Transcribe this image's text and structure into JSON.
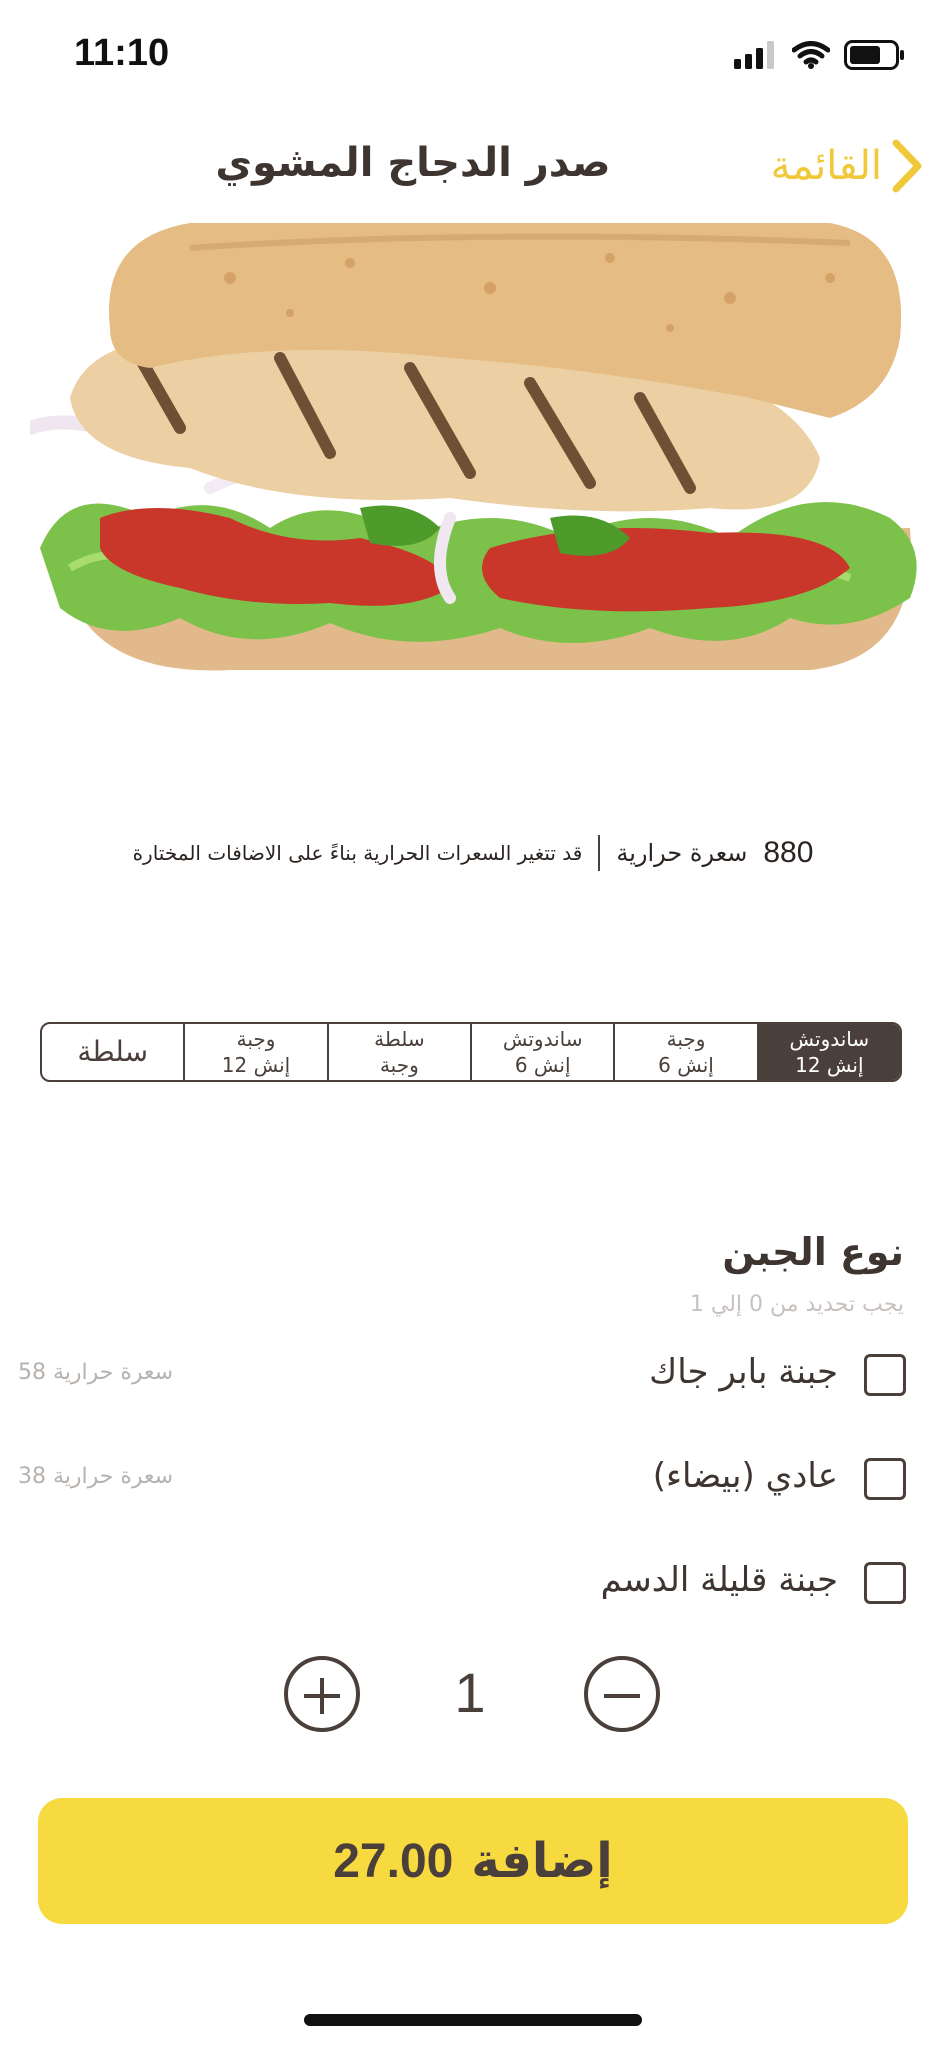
{
  "status": {
    "time": "11:10"
  },
  "nav": {
    "title": "صدر الدجاج المشوي",
    "back_label": "القائمة"
  },
  "calories": {
    "value": "880",
    "unit": "سعرة حرارية",
    "note": "قد تتغير السعرات الحرارية بناءً على الاضافات المختارة"
  },
  "sizes": [
    {
      "line1": "ساندوتش",
      "line2": "12 إنش",
      "selected": true
    },
    {
      "line1": "وجبة",
      "line2": "6 إنش",
      "selected": false
    },
    {
      "line1": "ساندوتش",
      "line2": "6 إنش",
      "selected": false
    },
    {
      "line1": "سلطة",
      "line2": "وجبة",
      "selected": false
    },
    {
      "line1": "وجبة",
      "line2": "12 إنش",
      "selected": false
    },
    {
      "line1": "سلطة",
      "line2": "",
      "selected": false
    }
  ],
  "cheese": {
    "title": "نوع الجبن",
    "hint": "يجب تحديد من 0 إلي 1",
    "options": [
      {
        "label": "جبنة بابر جاك",
        "calories": "58 سعرة حرارية",
        "checked": false
      },
      {
        "label": "عادي (بيضاء)",
        "calories": "38 سعرة حرارية",
        "checked": false
      },
      {
        "label": "جبنة قليلة الدسم",
        "calories": "",
        "checked": false
      }
    ]
  },
  "quantity": {
    "value": "1"
  },
  "add_button": {
    "label": "إضافة",
    "price": "27.00"
  },
  "colors": {
    "accent": "#f6da3f",
    "brand_dark": "#4a3f3a",
    "back_link": "#f0c93a"
  },
  "icons": [
    "signal-icon",
    "wifi-icon",
    "battery-icon",
    "chevron-left-icon",
    "plus-icon",
    "minus-icon"
  ]
}
